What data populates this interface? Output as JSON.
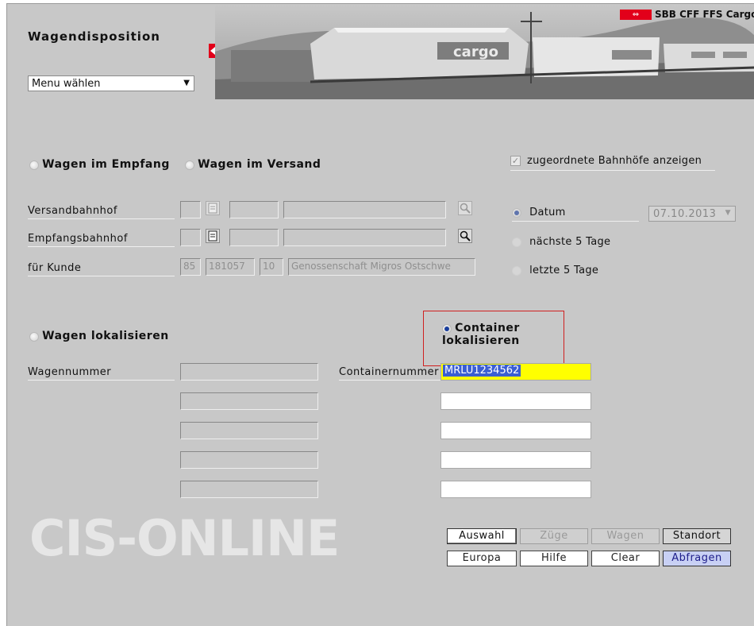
{
  "header": {
    "title": "Wagendisposition",
    "brand": "SBB CFF FFS Cargo",
    "banner_word": "cargo"
  },
  "menu": {
    "value": "Menu wählen"
  },
  "mode": {
    "empfang": "Wagen im Empfang",
    "versand": "Wagen im Versand",
    "assigned_stations": "zugeordnete Bahnhöfe anzeigen"
  },
  "stations": {
    "versand_label": "Versandbahnhof",
    "empfang_label": "Empfangsbahnhof",
    "kunde_label": "für Kunde",
    "kunde_code1": "85",
    "kunde_code2": "181057",
    "kunde_code3": "10",
    "kunde_name": "Genossenschaft Migros Ostschwe"
  },
  "date_options": {
    "datum": "Datum",
    "date_value": "07.10.2013",
    "next5": "nächste 5 Tage",
    "last5": "letzte 5 Tage"
  },
  "locate": {
    "wagen": "Wagen lokalisieren",
    "container": "Container lokalisieren",
    "wagennummer": "Wagennummer",
    "containernummer": "Containernummer",
    "container_value": "MRLU1234562"
  },
  "buttons": {
    "auswahl": "Auswahl",
    "zuege": "Züge",
    "wagen": "Wagen",
    "standort": "Standort",
    "europa": "Europa",
    "hilfe": "Hilfe",
    "clear": "Clear",
    "abfragen": "Abfragen"
  },
  "watermark": "CIS-ONLINE",
  "colors": {
    "highlight": "#ffff00",
    "selection": "#3a5ed2",
    "brand_red": "#e2001a"
  }
}
